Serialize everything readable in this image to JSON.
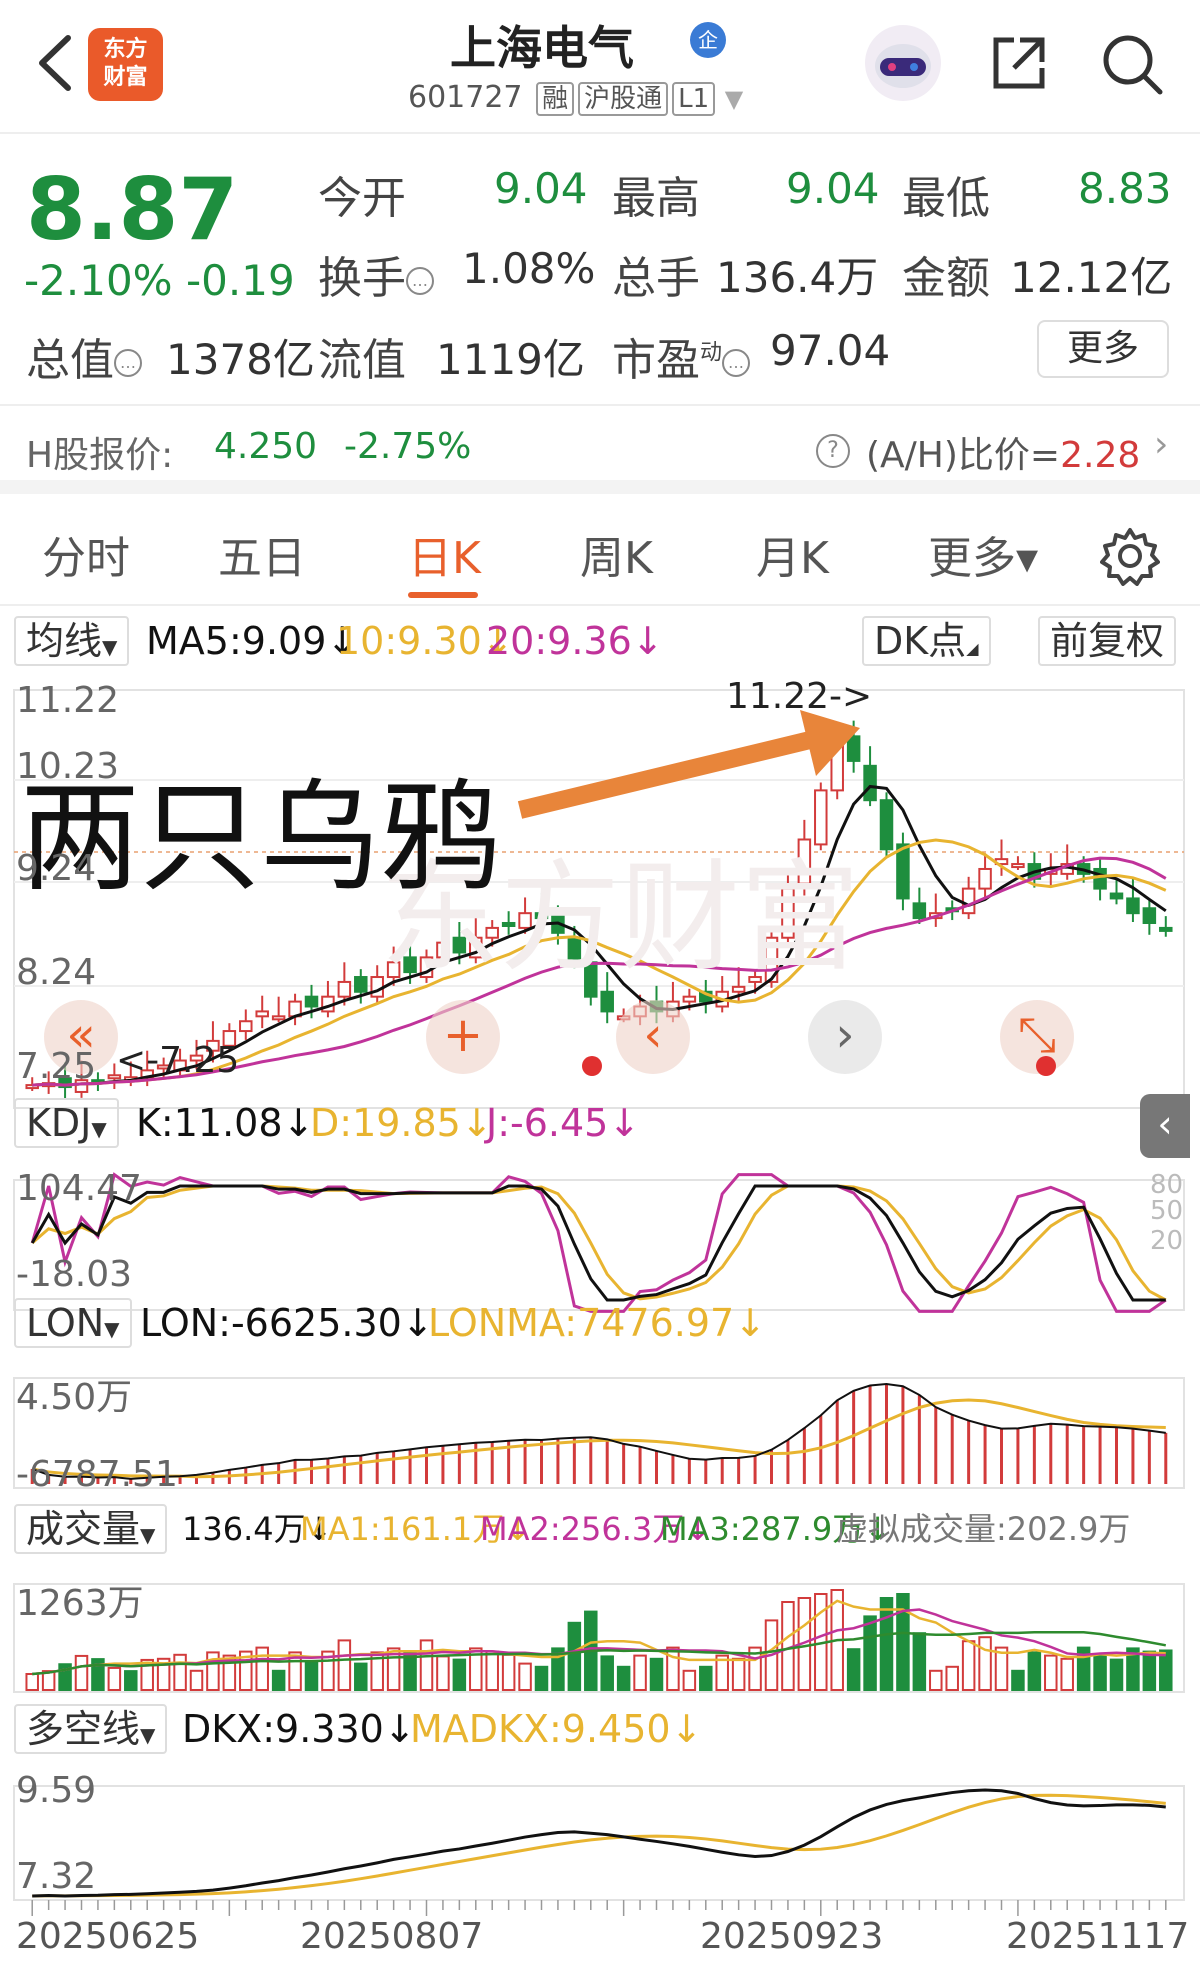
{
  "header": {
    "logo_line1": "东方",
    "logo_line2": "财富",
    "title": "上海电气",
    "qiye_badge": "企",
    "code": "601727",
    "tags": [
      "融",
      "沪股通",
      "L1"
    ],
    "icons": [
      "back-icon",
      "robot-avatar-icon",
      "share-icon",
      "search-icon",
      "dropdown-triangle-icon"
    ]
  },
  "quote": {
    "price": "8.87",
    "change_pct": "-2.10%",
    "change": "-0.19",
    "open_label": "今开",
    "open": "9.04",
    "high_label": "最高",
    "high": "9.04",
    "low_label": "最低",
    "low": "8.83",
    "turnover_label": "换手",
    "turnover": "1.08%",
    "volume_label": "总手",
    "volume": "136.4万",
    "amount_label": "金额",
    "amount": "12.12亿",
    "mktcap_label": "总值",
    "mktcap": "1378亿",
    "float_label": "流值",
    "float": "1119亿",
    "pe_label": "市盈",
    "pe_sup": "动",
    "pe": "97.04",
    "more_label": "更多"
  },
  "hshare": {
    "label": "H股报价:",
    "price": "4.250",
    "pct": "-2.75%",
    "ah_label": "(A/H)比价=",
    "ah_value": "2.28"
  },
  "tabs": [
    "分时",
    "五日",
    "日K",
    "周K",
    "月K",
    "更多▾"
  ],
  "active_tab": "日K",
  "ma_row": {
    "select": "均线",
    "ma5": "MA5:9.09↓",
    "ma10": "10:9.30↓",
    "ma20": "20:9.36↓",
    "dk_label": "DK点",
    "fq_label": "前复权"
  },
  "annotations": {
    "stamp_text": "两只乌鸦",
    "watermark": "东方财富",
    "high_marker": "11.22->",
    "low_marker": "<-7.25"
  },
  "kdj_row": {
    "select": "KDJ",
    "k": "K:11.08↓",
    "d": "D:19.85↓",
    "j": "J:-6.45↓"
  },
  "lon_row": {
    "select": "LON",
    "lon": "LON:-6625.30↓",
    "lonma": "LONMA:7476.97↓"
  },
  "vol_row": {
    "select": "成交量",
    "vol": "136.4万↓",
    "ma1": "MA1:161.1万↓",
    "ma2": "MA2:256.3万↓",
    "ma3": "MA3:287.9万↓",
    "virtual": "虚拟成交量:202.9万"
  },
  "dkx_row": {
    "select": "多空线",
    "dkx": "DKX:9.330↓",
    "madkx": "MADKX:9.450↓"
  },
  "colors": {
    "up": "#d23b3b",
    "down": "#1e8e3e",
    "accent": "#e8602c",
    "ma5": "#111111",
    "ma10": "#e8b430",
    "ma20": "#c0339a"
  },
  "chart_data": [
    {
      "type": "candlestick",
      "title": "日K",
      "ylabels": [
        "11.22",
        "10.23",
        "9.24",
        "8.24",
        "7.25"
      ],
      "ylim": [
        7.25,
        11.22
      ],
      "x": [
        "20250625",
        "20250807",
        "20250923",
        "20251117"
      ],
      "close": [
        7.3,
        7.32,
        7.28,
        7.35,
        7.33,
        7.4,
        7.38,
        7.45,
        7.5,
        7.55,
        7.6,
        7.75,
        7.85,
        7.95,
        8.05,
        8.0,
        8.15,
        8.1,
        8.2,
        8.35,
        8.25,
        8.4,
        8.55,
        8.45,
        8.6,
        8.75,
        8.65,
        8.8,
        8.9,
        8.95,
        9.05,
        9.0,
        8.85,
        8.55,
        8.2,
        8.05,
        8.0,
        8.1,
        8.05,
        8.15,
        8.2,
        8.15,
        8.25,
        8.3,
        8.4,
        8.8,
        9.3,
        9.8,
        10.3,
        10.8,
        10.6,
        10.2,
        9.7,
        9.2,
        9.0,
        9.05,
        9.1,
        9.3,
        9.5,
        9.6,
        9.55,
        9.4,
        9.5,
        9.55,
        9.45,
        9.3,
        9.2,
        9.05,
        8.95,
        8.87
      ],
      "ma5": "9.09",
      "ma10": "9.30",
      "ma20": "9.36"
    },
    {
      "type": "line",
      "title": "KDJ",
      "ylabels": [
        "104.47",
        "-18.03"
      ],
      "right_ticks": [
        "80",
        "50",
        "20"
      ],
      "values": {
        "K": 11.08,
        "D": 19.85,
        "J": -6.45
      }
    },
    {
      "type": "line",
      "title": "LON",
      "ylabels": [
        "4.50万",
        "-6787.51"
      ],
      "values": {
        "LON": -6625.3,
        "LONMA": 7476.97
      }
    },
    {
      "type": "bar",
      "title": "成交量",
      "ylabels": [
        "1263万"
      ],
      "values": {
        "VOL": "136.4万",
        "MA1": "161.1万",
        "MA2": "256.3万",
        "MA3": "287.9万"
      }
    },
    {
      "type": "line",
      "title": "多空线",
      "ylabels": [
        "9.59",
        "7.32"
      ],
      "values": {
        "DKX": 9.33,
        "MADKX": 9.45
      }
    }
  ]
}
